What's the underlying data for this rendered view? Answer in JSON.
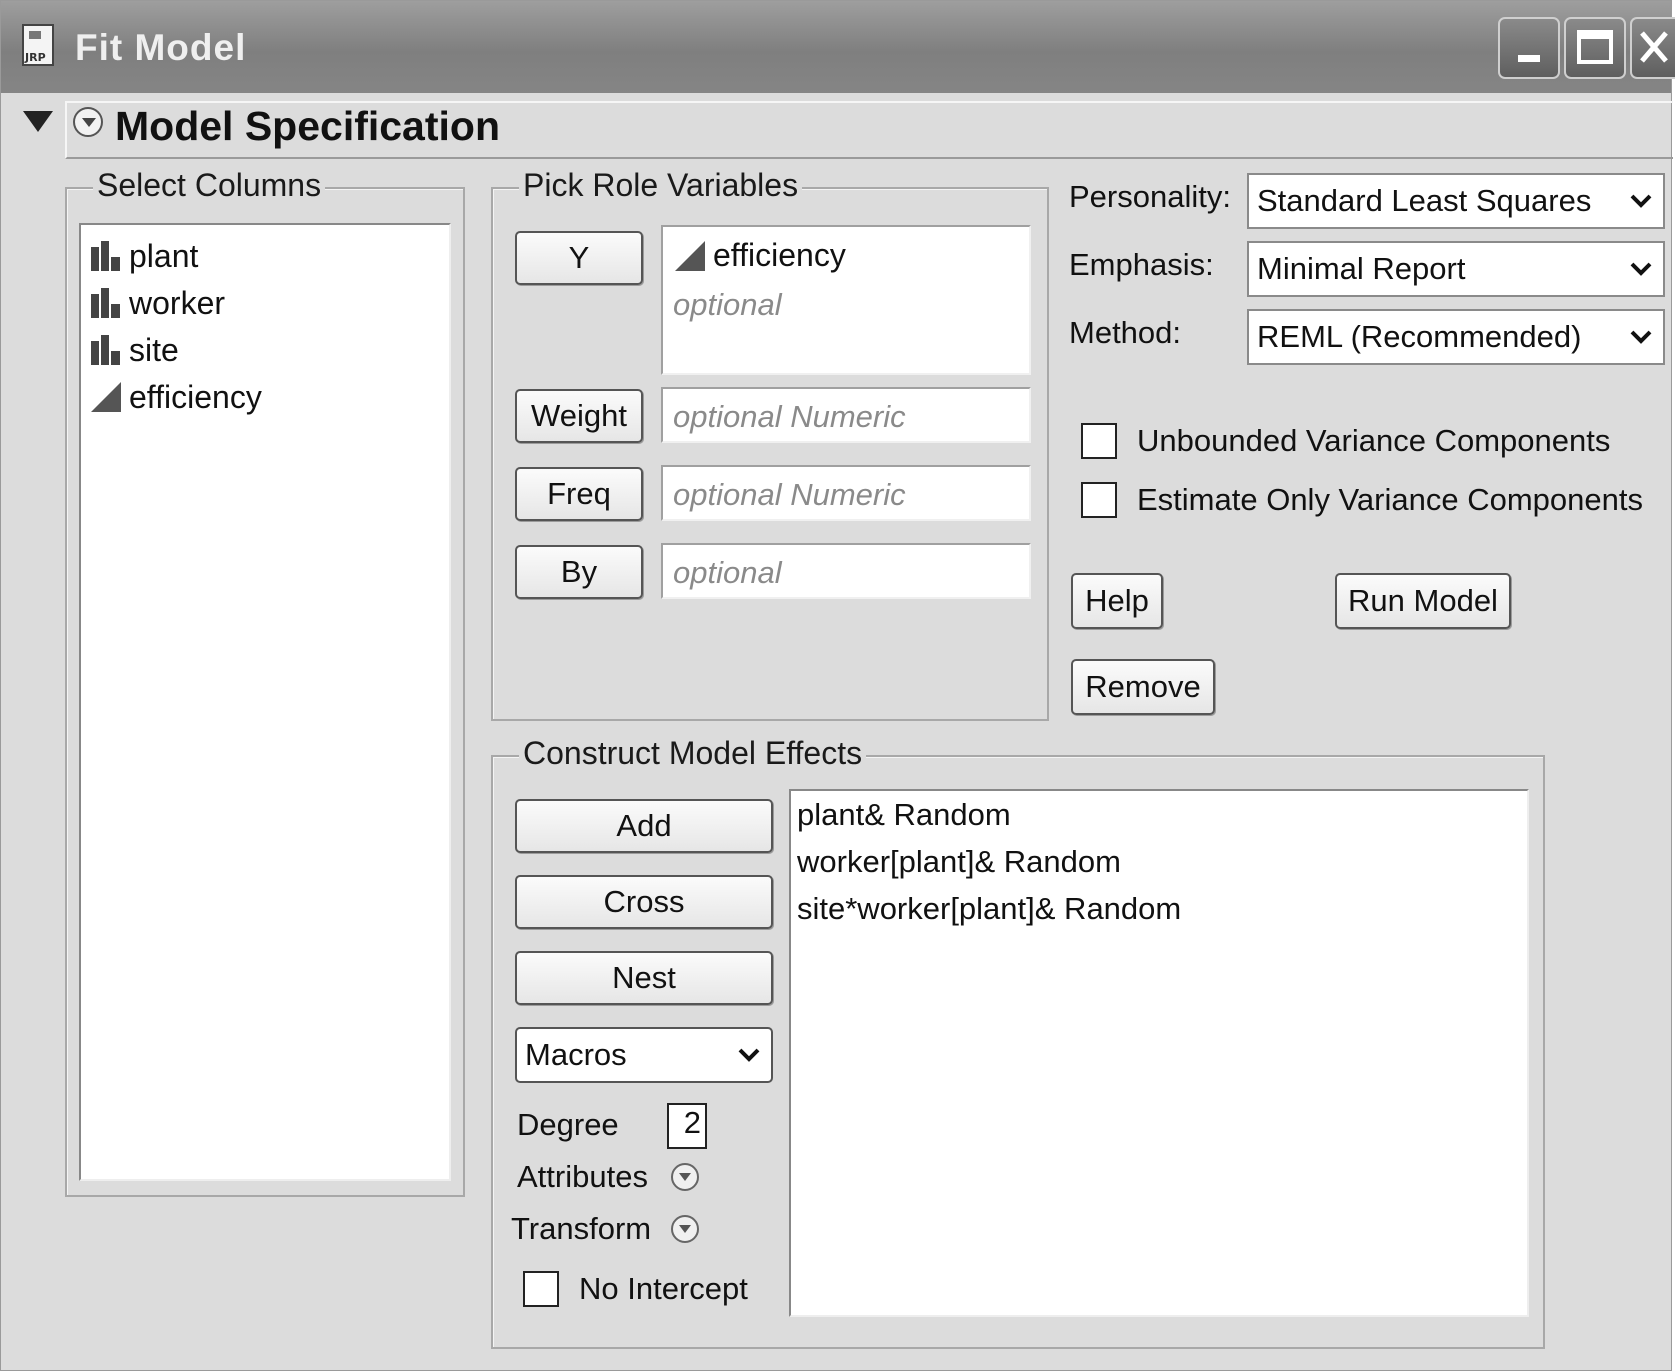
{
  "window": {
    "title": "Fit Model"
  },
  "outline": {
    "title": "Model Specification"
  },
  "select_columns": {
    "legend": "Select Columns",
    "items": [
      {
        "label": "plant",
        "icon": "nominal-bar-icon"
      },
      {
        "label": "worker",
        "icon": "nominal-bar-icon"
      },
      {
        "label": "site",
        "icon": "nominal-bar-icon"
      },
      {
        "label": "efficiency",
        "icon": "continuous-triangle-icon"
      }
    ]
  },
  "roles": {
    "legend": "Pick Role Variables",
    "y": {
      "button": "Y",
      "value": "efficiency",
      "placeholder": "optional"
    },
    "weight": {
      "button": "Weight",
      "placeholder": "optional Numeric"
    },
    "freq": {
      "button": "Freq",
      "placeholder": "optional Numeric"
    },
    "by": {
      "button": "By",
      "placeholder": "optional"
    }
  },
  "options": {
    "personality_label": "Personality:",
    "personality_value": "Standard Least Squares",
    "emphasis_label": "Emphasis:",
    "emphasis_value": "Minimal Report",
    "method_label": "Method:",
    "method_value": "REML (Recommended)",
    "unbounded_label": "Unbounded Variance Components",
    "unbounded_checked": false,
    "estimate_only_label": "Estimate Only Variance Components",
    "estimate_only_checked": false
  },
  "actions": {
    "help": "Help",
    "run": "Run Model",
    "remove": "Remove"
  },
  "effects": {
    "legend": "Construct Model Effects",
    "add": "Add",
    "cross": "Cross",
    "nest": "Nest",
    "macros": "Macros",
    "degree_label": "Degree",
    "degree_value": "2",
    "attributes_label": "Attributes",
    "transform_label": "Transform",
    "no_intercept_label": "No Intercept",
    "no_intercept_checked": false,
    "list": [
      "plant& Random",
      "worker[plant]& Random",
      "site*worker[plant]& Random"
    ]
  }
}
